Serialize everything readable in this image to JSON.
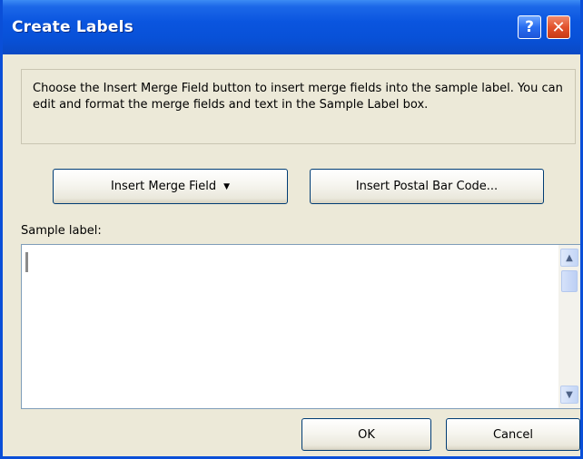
{
  "window": {
    "title": "Create Labels",
    "help_glyph": "?",
    "close_glyph": "✕"
  },
  "instructions": "Choose the Insert Merge Field button to insert merge fields into the sample label.  You can edit and format the merge fields and text in the Sample Label box.",
  "buttons": {
    "insert_merge_field": "Insert Merge Field",
    "insert_postal_bar_code": "Insert Postal Bar Code...",
    "ok": "OK",
    "cancel": "Cancel"
  },
  "sample_label": {
    "caption": "Sample label:",
    "value": ""
  },
  "icons": {
    "merge_dropdown": "caret-down-icon",
    "scroll_up": "chevron-up-icon",
    "scroll_down": "chevron-down-icon"
  },
  "colors": {
    "titlebar": "#0a55df",
    "dialog_bg": "#ece9d8",
    "close_button": "#e2522c"
  }
}
